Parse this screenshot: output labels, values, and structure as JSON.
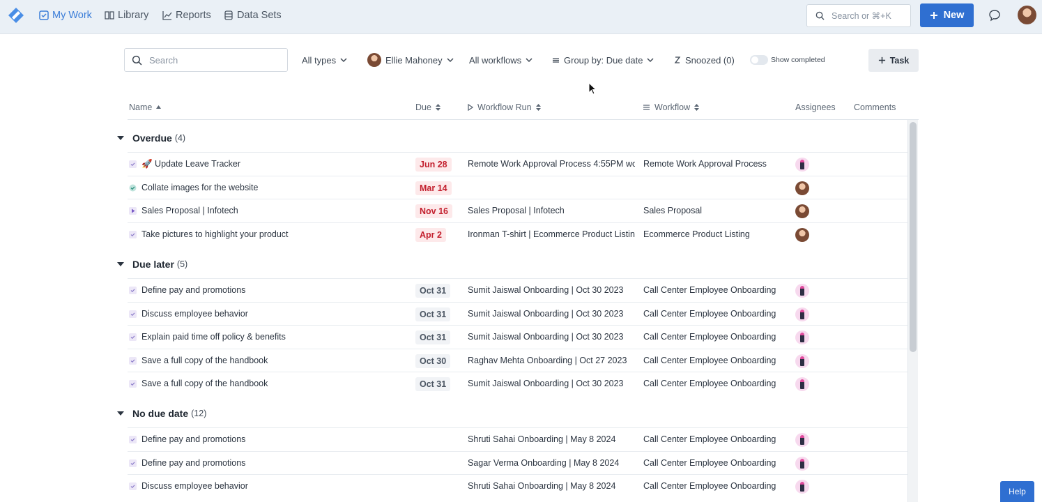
{
  "nav": {
    "items": [
      {
        "label": "My Work",
        "icon": "checkbox-icon",
        "active": true
      },
      {
        "label": "Library",
        "icon": "book-icon"
      },
      {
        "label": "Reports",
        "icon": "chart-line-icon"
      },
      {
        "label": "Data Sets",
        "icon": "database-icon"
      }
    ],
    "search_placeholder": "Search or ⌘+K",
    "new_label": "New"
  },
  "filters": {
    "search_placeholder": "Search",
    "types": "All types",
    "user": "Ellie Mahoney",
    "workflows": "All workflows",
    "group_by": "Group by: Due date",
    "snoozed": "Snoozed (0)",
    "show_completed": "Show completed",
    "task_label": "Task"
  },
  "columns": {
    "name": "Name",
    "due": "Due",
    "workflow_run": "Workflow Run",
    "workflow": "Workflow",
    "assignees": "Assignees",
    "comments": "Comments"
  },
  "groups": [
    {
      "name": "Overdue",
      "count": "(4)",
      "rows": [
        {
          "name": "🚀 Update Leave Tracker",
          "due": "Jun 28",
          "run": "Remote Work Approval Process 4:55PM wo",
          "workflow": "Remote Work Approval Process",
          "assignee": "robot",
          "icon": "checkbox"
        },
        {
          "name": "Collate images for the website",
          "due": "Mar 14",
          "run": "",
          "workflow": "",
          "assignee": "person",
          "icon": "check-circle"
        },
        {
          "name": "Sales Proposal | Infotech",
          "due": "Nov 16",
          "run": "Sales Proposal | Infotech",
          "workflow": "Sales Proposal",
          "assignee": "person",
          "icon": "play"
        },
        {
          "name": "Take pictures to highlight your product",
          "due": "Apr 2",
          "run": "Ironman T-shirt | Ecommerce Product Listin",
          "workflow": "Ecommerce Product Listing",
          "assignee": "person",
          "icon": "checkbox"
        }
      ]
    },
    {
      "name": "Due later",
      "count": "(5)",
      "rows": [
        {
          "name": "Define pay and promotions",
          "due": "Oct 31",
          "run": "Sumit Jaiswal Onboarding | Oct 30 2023",
          "workflow": "Call Center Employee Onboarding",
          "assignee": "robot",
          "icon": "checkbox"
        },
        {
          "name": "Discuss employee behavior",
          "due": "Oct 31",
          "run": "Sumit Jaiswal Onboarding | Oct 30 2023",
          "workflow": "Call Center Employee Onboarding",
          "assignee": "robot",
          "icon": "checkbox"
        },
        {
          "name": "Explain paid time off policy & benefits",
          "due": "Oct 31",
          "run": "Sumit Jaiswal Onboarding | Oct 30 2023",
          "workflow": "Call Center Employee Onboarding",
          "assignee": "robot",
          "icon": "checkbox"
        },
        {
          "name": "Save a full copy of the handbook",
          "due": "Oct 30",
          "run": "Raghav Mehta Onboarding | Oct 27 2023",
          "workflow": "Call Center Employee Onboarding",
          "assignee": "robot",
          "icon": "checkbox"
        },
        {
          "name": "Save a full copy of the handbook",
          "due": "Oct 31",
          "run": "Sumit Jaiswal Onboarding | Oct 30 2023",
          "workflow": "Call Center Employee Onboarding",
          "assignee": "robot",
          "icon": "checkbox"
        }
      ]
    },
    {
      "name": "No due date",
      "count": "(12)",
      "rows": [
        {
          "name": "Define pay and promotions",
          "due": "",
          "run": "Shruti Sahai Onboarding | May 8 2024",
          "workflow": "Call Center Employee Onboarding",
          "assignee": "robot",
          "icon": "checkbox"
        },
        {
          "name": "Define pay and promotions",
          "due": "",
          "run": "Sagar Verma Onboarding | May 8 2024",
          "workflow": "Call Center Employee Onboarding",
          "assignee": "robot",
          "icon": "checkbox"
        },
        {
          "name": "Discuss employee behavior",
          "due": "",
          "run": "Shruti Sahai Onboarding | May 8 2024",
          "workflow": "Call Center Employee Onboarding",
          "assignee": "robot",
          "icon": "checkbox"
        }
      ]
    }
  ],
  "help_label": "Help",
  "colors": {
    "accent": "#2f6fd1",
    "overdue_bg": "#fde9ea",
    "overdue_text": "#c3202e",
    "nav_bg": "#eaf0f6"
  }
}
